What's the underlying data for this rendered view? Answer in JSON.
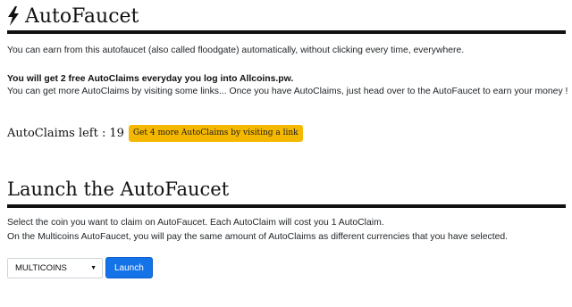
{
  "section1": {
    "icon": "lightning-bolt-icon",
    "title": "AutoFaucet",
    "description": "You can earn from this autofaucet (also called floodgate) automatically, without clicking every time, everywhere.",
    "bonus_text": "You will get 2 free AutoClaims everyday you log into Allcoins.pw.",
    "more_text": "You can get more AutoClaims by visiting some links... Once you have AutoClaims, just head over to the AutoFaucet to earn your money !"
  },
  "claims": {
    "label": "AutoClaims left :",
    "count": "19",
    "button_label": "Get 4 more AutoClaims by visiting a link",
    "button_color": "#f5b800"
  },
  "section2": {
    "title": "Launch the AutoFaucet",
    "instruction": "Select the coin you want to claim on AutoFaucet. Each AutoClaim will cost you 1 AutoClaim.",
    "multicoins_note": "On the Multicoins AutoFaucet, you will pay the same amount of AutoClaims as different currencies that you have selected."
  },
  "launch": {
    "selected_coin": "MULTICOINS",
    "button_label": "Launch",
    "button_color": "#1473e6"
  }
}
